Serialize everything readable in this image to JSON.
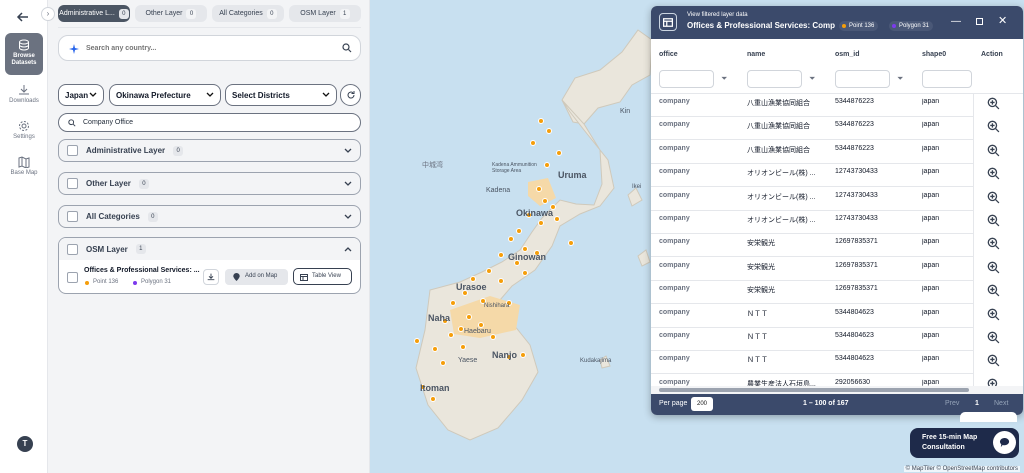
{
  "rail": {
    "items": [
      {
        "label": "Browse Datasets",
        "icon": "database-icon"
      },
      {
        "label": "Downloads",
        "icon": "download-icon"
      },
      {
        "label": "Settings",
        "icon": "gear-icon"
      },
      {
        "label": "Base Map",
        "icon": "map-icon"
      }
    ],
    "avatar_letter": "T"
  },
  "tabs": [
    {
      "label": "Administrative L...",
      "count": "0"
    },
    {
      "label": "Other Layer",
      "count": "0"
    },
    {
      "label": "All Categories",
      "count": "0"
    },
    {
      "label": "OSM Layer",
      "count": "1"
    }
  ],
  "search": {
    "placeholder": "Search any country..."
  },
  "filters": {
    "country": "Japan",
    "prefecture": "Okinawa Prefecture",
    "districts": "Select Districts"
  },
  "category_search": {
    "value": "Company Office"
  },
  "layers": [
    {
      "label": "Administrative Layer",
      "count": "0"
    },
    {
      "label": "Other Layer",
      "count": "0"
    },
    {
      "label": "All Categories",
      "count": "0"
    },
    {
      "label": "OSM Layer",
      "count": "1"
    }
  ],
  "osm_item": {
    "title": "Offices & Professional Services: ...",
    "point_label": "Point 136",
    "polygon_label": "Polygon 31",
    "add_on_map": "Add on Map",
    "table_view": "Table View"
  },
  "colors": {
    "point": "#f59e0b",
    "polygon": "#7c3aed",
    "header": "#3b4a6b"
  },
  "map": {
    "labels": [
      "Uruma",
      "Okinawa",
      "Ginowan",
      "Urasoe",
      "Naha",
      "Nishihara",
      "Haebaru",
      "Yaese",
      "Nanjo",
      "Itoman",
      "Kin",
      "Kadena",
      "Kadena Ammunition Storage Area",
      "Kudakajima",
      "Ikei",
      "中城湾"
    ],
    "attribution": "© MapTiler © OpenStreetMap contributors"
  },
  "table": {
    "subtitle": "View filtered layer data",
    "title": "Offices & Professional Services: Compa...",
    "point_badge": "Point 136",
    "polygon_badge": "Polygon 31",
    "columns": [
      "office",
      "name",
      "osm_id",
      "shape0",
      "Action"
    ],
    "rows": [
      [
        "company",
        "八重山漁業協同組合",
        "5344876223",
        "japan"
      ],
      [
        "company",
        "八重山漁業協同組合",
        "5344876223",
        "japan"
      ],
      [
        "company",
        "八重山漁業協同組合",
        "5344876223",
        "japan"
      ],
      [
        "company",
        "オリオンビール(株) ...",
        "12743730433",
        "japan"
      ],
      [
        "company",
        "オリオンビール(株) ...",
        "12743730433",
        "japan"
      ],
      [
        "company",
        "オリオンビール(株) ...",
        "12743730433",
        "japan"
      ],
      [
        "company",
        "安栄観光",
        "12697835371",
        "japan"
      ],
      [
        "company",
        "安栄観光",
        "12697835371",
        "japan"
      ],
      [
        "company",
        "安栄観光",
        "12697835371",
        "japan"
      ],
      [
        "company",
        "ＮＴＴ",
        "5344804623",
        "japan"
      ],
      [
        "company",
        "ＮＴＴ",
        "5344804623",
        "japan"
      ],
      [
        "company",
        "ＮＴＴ",
        "5344804623",
        "japan"
      ],
      [
        "company",
        "農業生産法人石垣島...",
        "292056630",
        "japan"
      ]
    ],
    "per_page_label": "Per page",
    "per_page_value": "200",
    "range": "1 – 100 of 167",
    "prev": "Prev",
    "page": "1",
    "next": "Next"
  },
  "consult": {
    "line1": "Free 15-min Map",
    "line2": "Consultation"
  }
}
